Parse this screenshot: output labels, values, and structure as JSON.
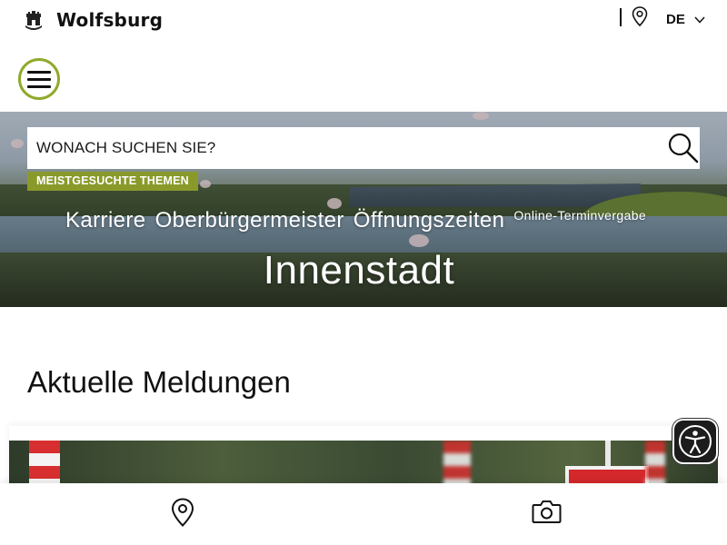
{
  "header": {
    "site_name": "Wolfsburg",
    "logo_icon": "wolfsburg-crest-icon",
    "location_icon": "map-pin-icon",
    "language": "DE",
    "language_icon": "chevron-down-icon"
  },
  "menu": {
    "icon": "hamburger-menu-icon"
  },
  "hero": {
    "search": {
      "placeholder": "WONACH SUCHEN SIE?",
      "icon": "search-icon"
    },
    "popular_label": "MEISTGESUCHTE THEMEN",
    "popular_topics": [
      "Karriere",
      "Oberbürgermeister",
      "Öffnungszeiten",
      "Online-Terminvergabe"
    ],
    "title": "Innenstadt"
  },
  "news": {
    "heading": "Aktuelle Meldungen"
  },
  "accessibility": {
    "icon": "accessibility-person-icon"
  },
  "bottom_nav": {
    "items": [
      {
        "icon": "map-pin-icon"
      },
      {
        "icon": "camera-icon"
      }
    ]
  },
  "colors": {
    "accent_green": "#8faa2a",
    "tag_green": "#8a9a2a",
    "text_dark": "#111111"
  }
}
